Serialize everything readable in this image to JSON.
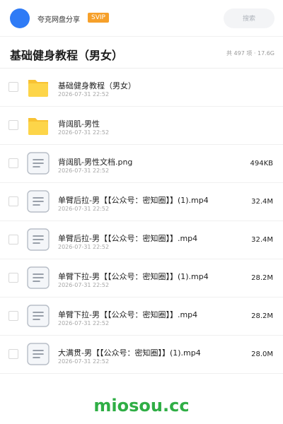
{
  "header": {
    "share_name": "夸克网盘分享",
    "badge": "SVIP",
    "search_label": "搜索",
    "avatar_color": "#2f7bf6",
    "badge_color": "#f6a02a"
  },
  "folder": {
    "title": "基础健身教程（男女）",
    "summary": "共 497 项 · 17.6G"
  },
  "files": [
    {
      "type": "folder",
      "icon": "folder-icon",
      "name": "基础健身教程（男女）",
      "date": "2026-07-31 22:52",
      "size": ""
    },
    {
      "type": "folder",
      "icon": "folder-icon",
      "name": "背阔肌-男性",
      "date": "2026-07-31 22:52",
      "size": ""
    },
    {
      "type": "file",
      "icon": "document-icon",
      "name": "背阔肌-男性文档.png",
      "date": "2026-07-31 22:52",
      "size": "494KB"
    },
    {
      "type": "file",
      "icon": "document-icon",
      "name": "单臂后拉-男【【公众号：密知圈】】(1).mp4",
      "date": "2026-07-31 22:52",
      "size": "32.4M"
    },
    {
      "type": "file",
      "icon": "document-icon",
      "name": "单臂后拉-男【【公众号：密知圈】】.mp4",
      "date": "2026-07-31 22:52",
      "size": "32.4M"
    },
    {
      "type": "file",
      "icon": "document-icon",
      "name": "单臂下拉-男【【公众号：密知圈】】(1).mp4",
      "date": "2026-07-31 22:52",
      "size": "28.2M"
    },
    {
      "type": "file",
      "icon": "document-icon",
      "name": "单臂下拉-男【【公众号：密知圈】】.mp4",
      "date": "2026-07-31 22:52",
      "size": "28.2M"
    },
    {
      "type": "file",
      "icon": "document-icon",
      "name": "大满贯-男【【公众号：密知圈】】(1).mp4",
      "date": "2026-07-31 22:52",
      "size": "28.0M"
    }
  ],
  "watermark": "miosou.cc"
}
